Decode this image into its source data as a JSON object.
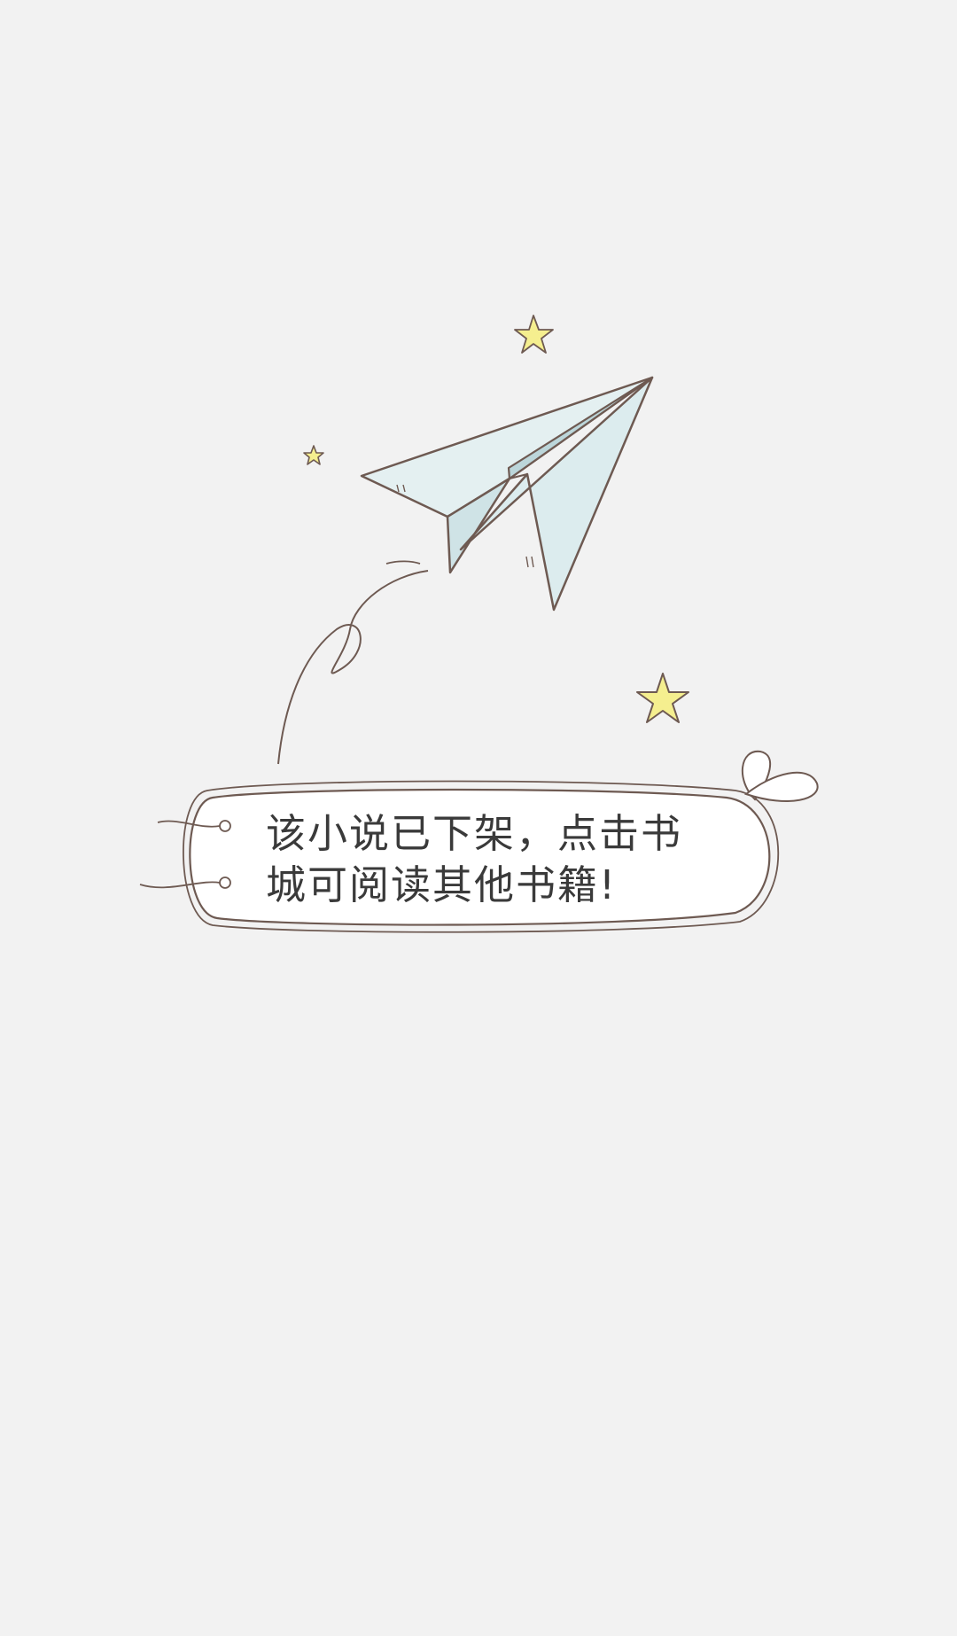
{
  "empty_state": {
    "message_lines": [
      "该小说已下架，点击书",
      "城可阅读其他书籍!"
    ],
    "illustration_icon": "paper-plane-icon",
    "decoration_icons": [
      "star-icon",
      "speech-bubble-icon"
    ]
  },
  "colors": {
    "background": "#f2f2f2",
    "line": "#6e5a52",
    "plane_fill": "#dcecee",
    "star_fill": "#f5ef8f",
    "text": "#3a3a3a"
  }
}
